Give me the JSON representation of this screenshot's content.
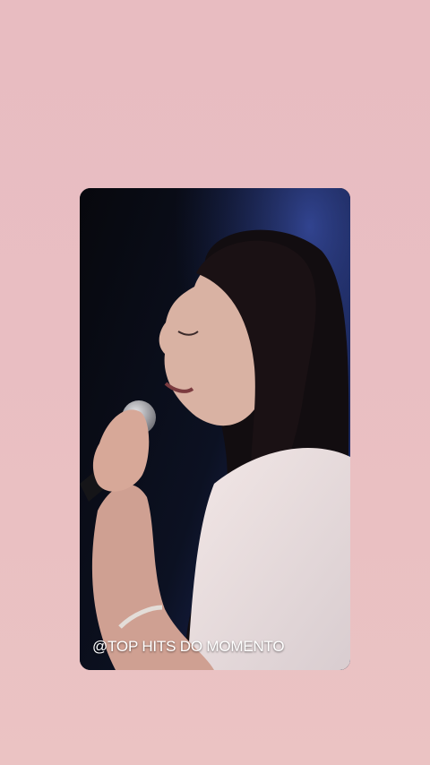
{
  "story": {
    "caption": "@TOP HITS DO MOMENTO",
    "background_color": "#e9bec2"
  }
}
